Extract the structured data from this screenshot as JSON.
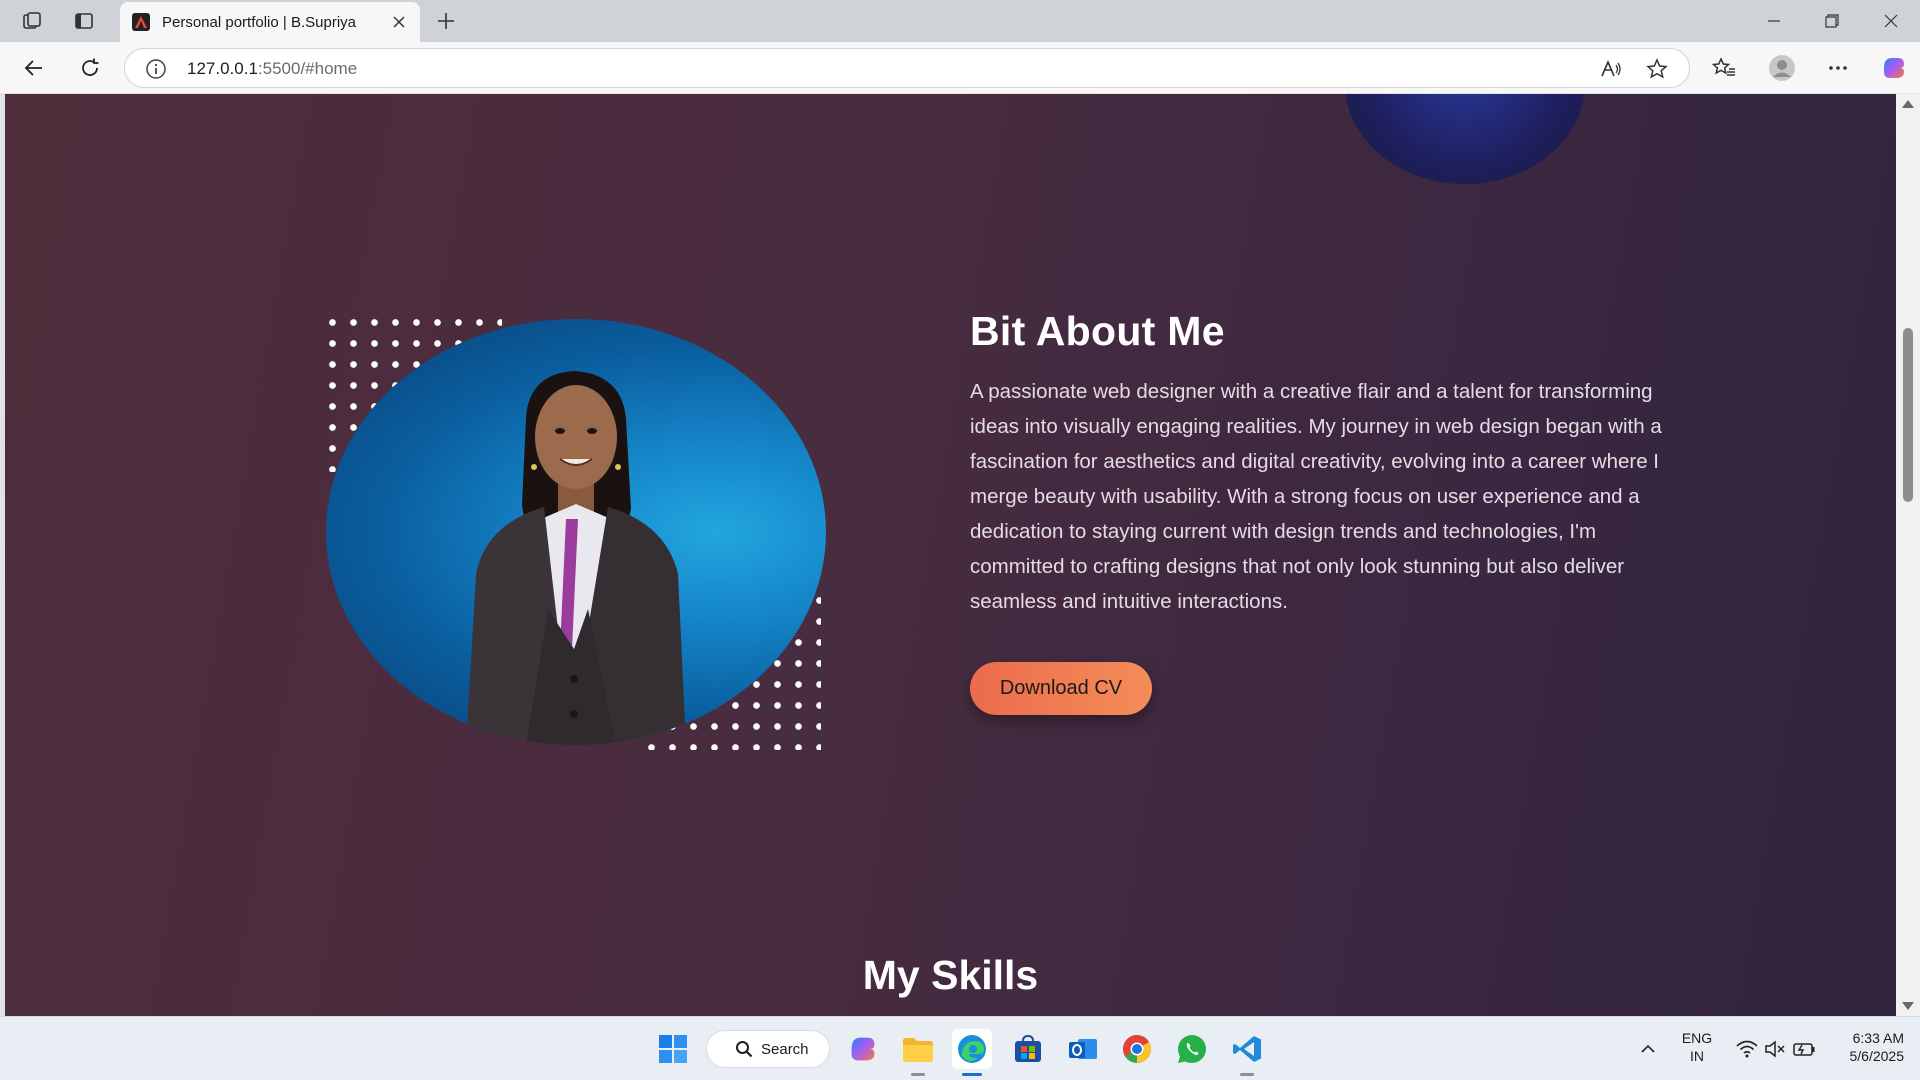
{
  "browser": {
    "tab_title": "Personal portfolio | B.Supriya",
    "url_host": "127.0.0.1",
    "url_rest": ":5500/#home"
  },
  "about": {
    "title": "Bit About Me",
    "text": "A passionate web designer with a creative flair and a talent for transforming ideas into visually engaging realities. My journey in web design began with a fascination for aesthetics and digital creativity, evolving into a career where I merge beauty with usability. With a strong focus on user experience and a dedication to staying current with design trends and technologies, I'm committed to crafting designs that not only look stunning but also deliver seamless and intuitive interactions.",
    "cv_button": "Download CV"
  },
  "skills": {
    "title": "My Skills"
  },
  "taskbar": {
    "search_label": "Search",
    "lang_primary": "ENG",
    "lang_region": "IN",
    "time": "6:33 AM",
    "date": "5/6/2025"
  },
  "colors": {
    "accent_start": "#ec6b4d",
    "accent_end": "#f48d58",
    "page_bg_left": "#4f2d3b",
    "page_bg_right": "#2f233e",
    "photo_bg": "#1484c7"
  },
  "icons": [
    "workspaces-icon",
    "tab-actions-icon",
    "app-favicon",
    "close-tab-icon",
    "new-tab-icon",
    "minimize-icon",
    "restore-icon",
    "close-window-icon",
    "back-icon",
    "refresh-icon",
    "site-info-icon",
    "read-aloud-icon",
    "favorite-star-icon",
    "favorites-icon",
    "profile-icon",
    "more-icon",
    "copilot-icon",
    "windows-start-icon",
    "search-icon",
    "copilot-app-icon",
    "file-explorer-icon",
    "edge-icon",
    "store-icon",
    "outlook-icon",
    "chrome-icon",
    "whatsapp-icon",
    "vscode-icon",
    "tray-chevron-icon",
    "wifi-icon",
    "volume-muted-icon",
    "battery-icon"
  ]
}
